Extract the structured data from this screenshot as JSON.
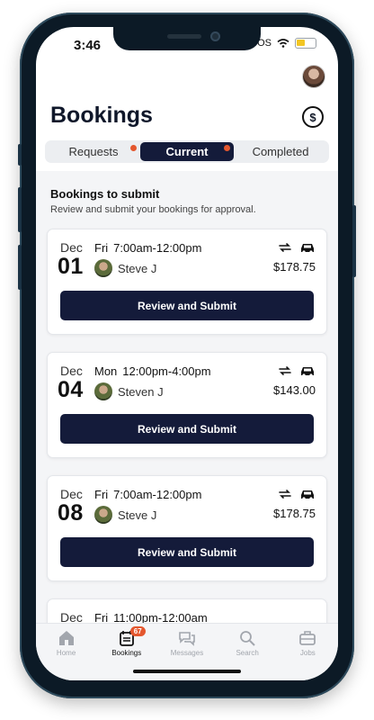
{
  "status": {
    "time": "3:46",
    "carrier": "OS"
  },
  "header": {
    "title": "Bookings"
  },
  "tabs": [
    {
      "label": "Requests",
      "dot": true
    },
    {
      "label": "Current",
      "dot": true
    },
    {
      "label": "Completed",
      "dot": false
    }
  ],
  "section": {
    "title": "Bookings to submit",
    "subtitle": "Review and submit your bookings for approval."
  },
  "bookings": [
    {
      "month": "Dec",
      "day": "01",
      "dow": "Fri",
      "time": "7:00am-12:00pm",
      "name": "Steve J",
      "price": "$178.75",
      "button": "Review and Submit"
    },
    {
      "month": "Dec",
      "day": "04",
      "dow": "Mon",
      "time": "12:00pm-4:00pm",
      "name": "Steven J",
      "price": "$143.00",
      "button": "Review and Submit"
    },
    {
      "month": "Dec",
      "day": "08",
      "dow": "Fri",
      "time": "7:00am-12:00pm",
      "name": "Steve J",
      "price": "$178.75",
      "button": "Review and Submit"
    },
    {
      "month": "Dec",
      "dow": "Fri",
      "time": "11:00pm-12:00am"
    }
  ],
  "nav": [
    {
      "label": "Home",
      "icon": "home-icon"
    },
    {
      "label": "Bookings",
      "icon": "bookings-icon",
      "badge": "67"
    },
    {
      "label": "Messages",
      "icon": "messages-icon"
    },
    {
      "label": "Search",
      "icon": "search-icon"
    },
    {
      "label": "Jobs",
      "icon": "jobs-icon"
    }
  ],
  "colors": {
    "navy": "#141b3a",
    "accent_dot": "#e4572e"
  }
}
